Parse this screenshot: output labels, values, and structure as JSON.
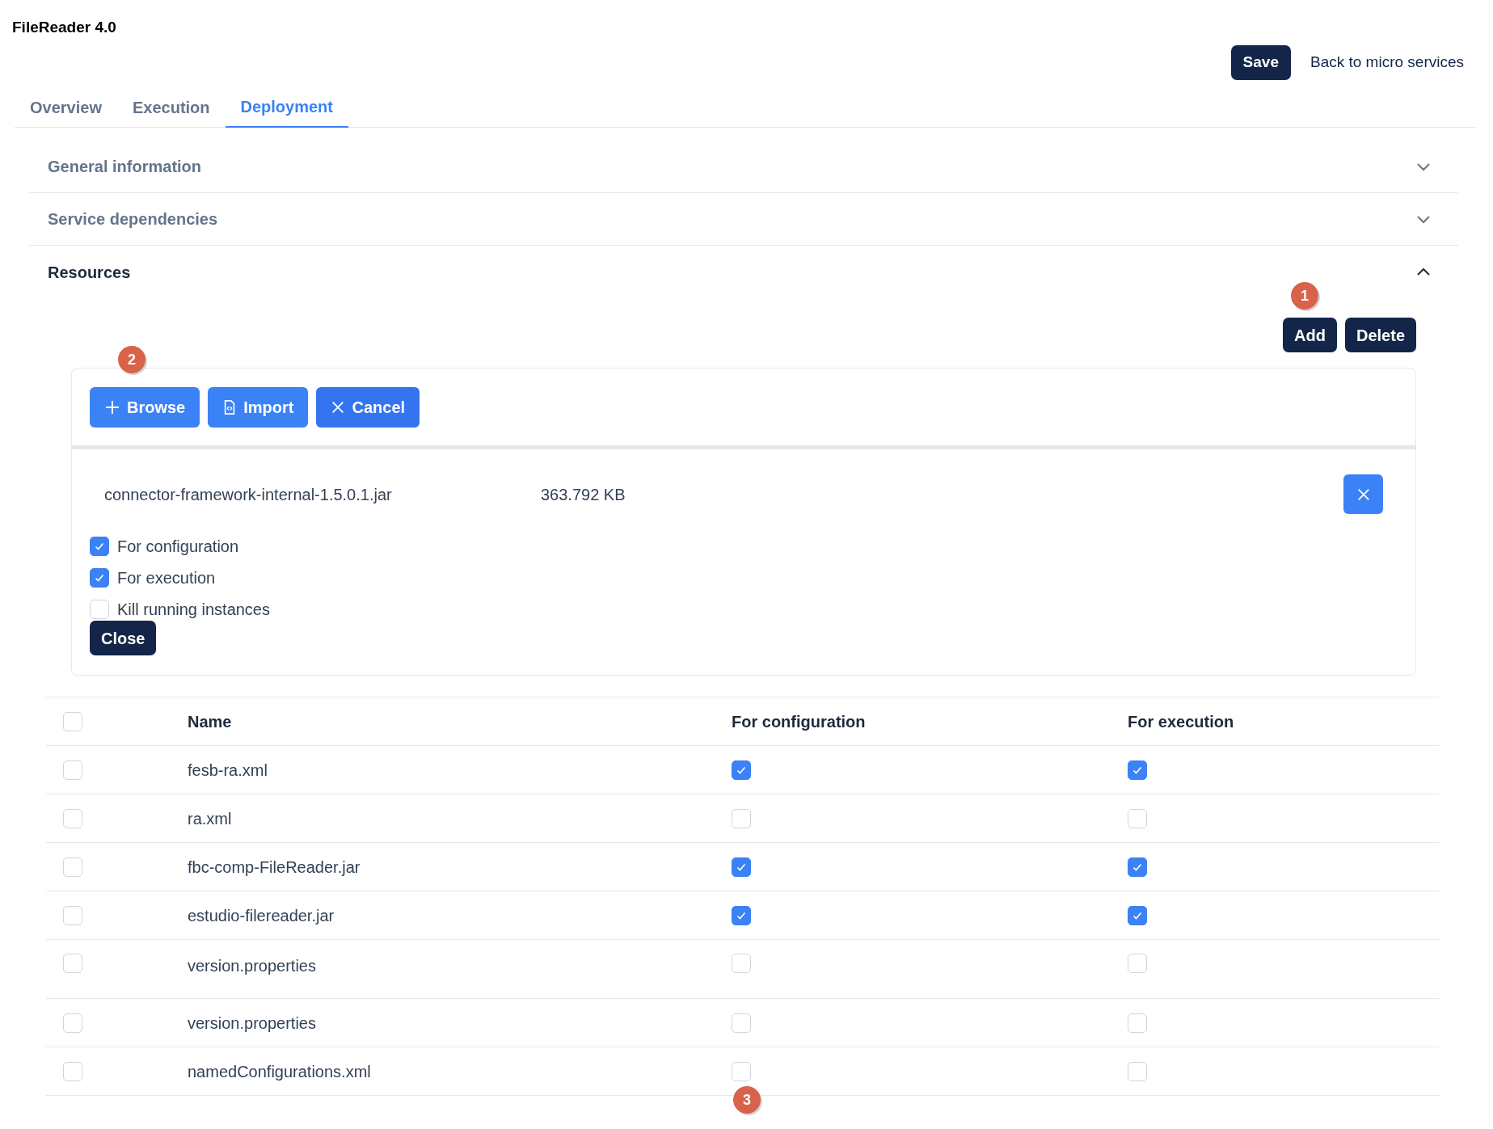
{
  "app_title": "FileReader 4.0",
  "header_actions": [
    {
      "label": "Save",
      "kind": "primary"
    },
    {
      "label": "Back to micro services",
      "kind": "link"
    }
  ],
  "tabs": [
    {
      "label": "Overview",
      "selected": false
    },
    {
      "label": "Execution",
      "selected": false
    },
    {
      "label": "Deployment",
      "selected": true
    }
  ],
  "sections": [
    {
      "title": "General information",
      "expanded": false
    },
    {
      "title": "Service dependencies",
      "expanded": false
    },
    {
      "title": "Resources",
      "expanded": true
    }
  ],
  "resource_actions": [
    "Add",
    "Delete"
  ],
  "upload": {
    "buttons": [
      {
        "label": "Browse",
        "kind": "plus"
      },
      {
        "label": "Import",
        "kind": "file"
      },
      {
        "label": "Cancel",
        "kind": "cancel"
      }
    ],
    "file": {
      "name": "connector-framework-internal-1.5.0.1.jar",
      "size": "363.792 KB"
    },
    "options": [
      {
        "label": "For configuration",
        "checked": true
      },
      {
        "label": "For execution",
        "checked": true
      },
      {
        "label": "Kill running instances",
        "checked": false
      }
    ],
    "close_label": "Close"
  },
  "table": {
    "columns": [
      "Name",
      "For configuration",
      "For execution"
    ],
    "all_selected": false,
    "rows": [
      {
        "name": "fesb-ra.xml",
        "selected": false,
        "for_configuration": true,
        "for_execution": true
      },
      {
        "name": "ra.xml",
        "selected": false,
        "for_configuration": false,
        "for_execution": false
      },
      {
        "name": "fbc-comp-FileReader.jar",
        "selected": false,
        "for_configuration": true,
        "for_execution": true
      },
      {
        "name": "estudio-filereader.jar",
        "selected": false,
        "for_configuration": true,
        "for_execution": true
      },
      {
        "name": "version.properties",
        "selected": false,
        "for_configuration": false,
        "for_execution": false
      },
      {
        "name": "version.properties",
        "selected": false,
        "for_configuration": false,
        "for_execution": false
      },
      {
        "name": "namedConfigurations.xml",
        "selected": false,
        "for_configuration": false,
        "for_execution": false
      }
    ]
  },
  "annotations": [
    {
      "label": "1"
    },
    {
      "label": "2"
    },
    {
      "label": "3"
    }
  ]
}
